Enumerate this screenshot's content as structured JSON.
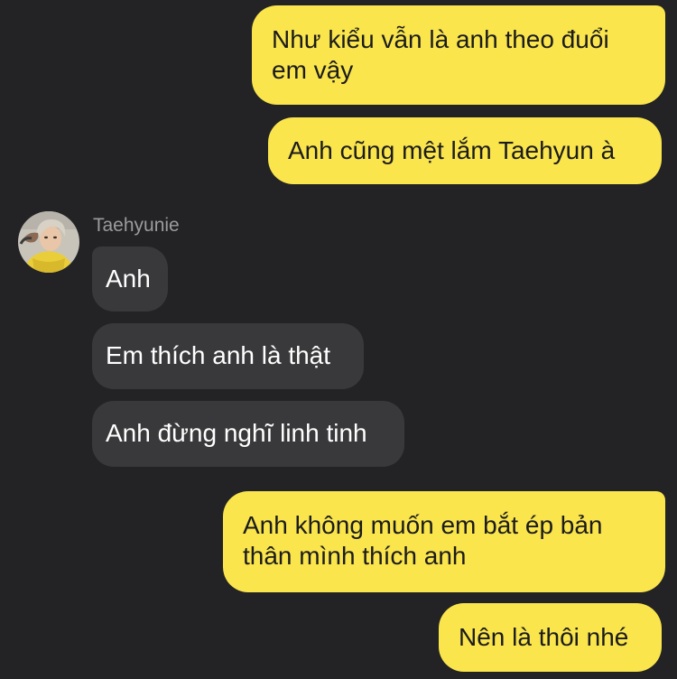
{
  "conversation": {
    "sender_name": "Taehyunie",
    "messages_sent_top": [
      "Như kiểu vẫn là anh theo đuổi\nem vậy",
      "Anh cũng mệt lắm Taehyun à"
    ],
    "messages_received": [
      "Anh",
      "Em thích anh là thật",
      "Anh đừng nghĩ linh tinh"
    ],
    "messages_sent_bottom": [
      "Anh không muốn em bắt ép bản\nthân mình thích anh",
      "Nên là thôi nhé"
    ]
  },
  "colors": {
    "background": "#232325",
    "outgoing_bubble": "#FAE54D",
    "incoming_bubble": "#39393B",
    "sender_name": "#9B9B9D"
  }
}
